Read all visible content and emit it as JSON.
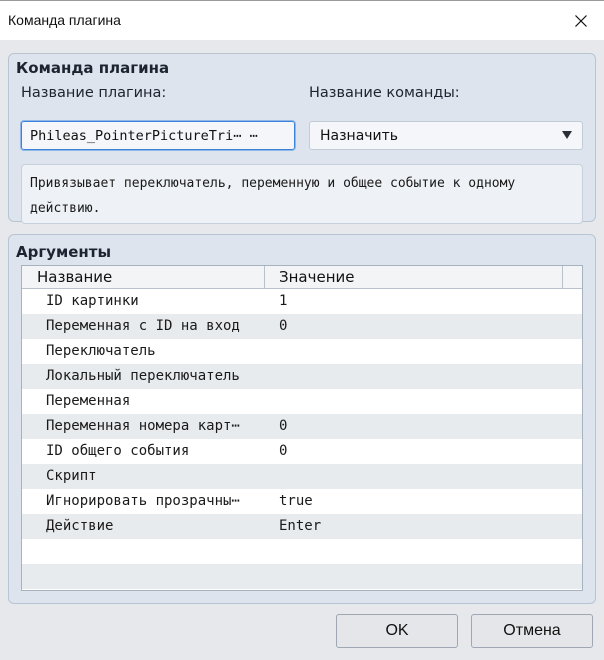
{
  "window": {
    "title": "Команда плагина"
  },
  "command_group": {
    "title": "Команда плагина",
    "plugin_label": "Название плагина:",
    "plugin_value": "Phileas_PointerPictureTri⋯ ⋯",
    "command_label": "Название команды:",
    "command_value": "Назначить",
    "description": "Привязывает переключатель, переменную и общее событие к одному действию."
  },
  "args_group": {
    "title": "Аргументы",
    "columns": {
      "name": "Название",
      "value": "Значение"
    },
    "rows": [
      {
        "name": "ID картинки",
        "value": "1"
      },
      {
        "name": "Переменная с ID на вход",
        "value": "0"
      },
      {
        "name": "Переключатель",
        "value": ""
      },
      {
        "name": "Локальный переключатель",
        "value": ""
      },
      {
        "name": "Переменная",
        "value": ""
      },
      {
        "name": "Переменная номера карт⋯",
        "value": "0"
      },
      {
        "name": "ID общего события",
        "value": "0"
      },
      {
        "name": "Скрипт",
        "value": ""
      },
      {
        "name": "Игнорировать прозрачны⋯",
        "value": "true"
      },
      {
        "name": "Действие",
        "value": "Enter"
      }
    ]
  },
  "buttons": {
    "ok": "OK",
    "cancel": "Отмена"
  }
}
